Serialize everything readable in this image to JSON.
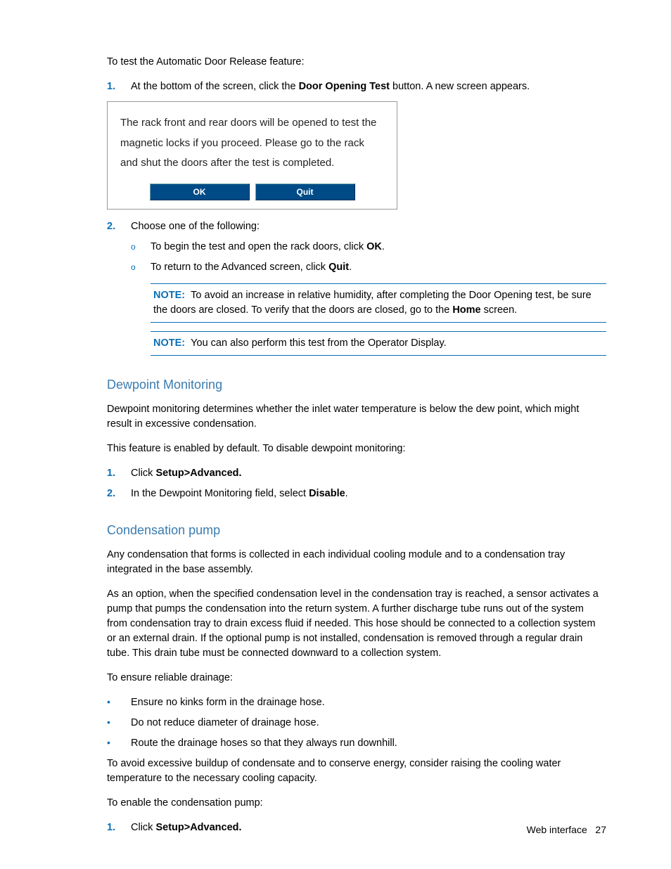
{
  "intro": "To test the Automatic Door Release feature:",
  "step1_pre": "At the bottom of the screen, click the ",
  "step1_bold": "Door Opening Test",
  "step1_post": " button. A new screen appears.",
  "dialog_text": "The rack front and rear doors will be opened to test the magnetic locks if you proceed. Please go to the rack and shut the doors after the test is completed.",
  "dialog_ok": "OK",
  "dialog_quit": "Quit",
  "step2": "Choose one of the following:",
  "sub_a_pre": "To begin the test and open the rack doors, click ",
  "sub_a_bold": "OK",
  "sub_a_post": ".",
  "sub_b_pre": "To return to the Advanced screen, click ",
  "sub_b_bold": "Quit",
  "sub_b_post": ".",
  "note_label": "NOTE:",
  "note1_pre": "To avoid an increase in relative humidity, after completing the Door Opening test, be sure the doors are closed. To verify that the doors are closed, go to the ",
  "note1_bold": "Home",
  "note1_post": " screen.",
  "note2": "You can also perform this test from the Operator Display.",
  "h_dew": "Dewpoint Monitoring",
  "dew_p1": "Dewpoint monitoring determines whether the inlet water temperature is below the dew point, which might result in excessive condensation.",
  "dew_p2": "This feature is enabled by default. To disable dewpoint monitoring:",
  "dew_s1_pre": "Click ",
  "dew_s1_bold": "Setup>Advanced.",
  "dew_s2_pre": "In the Dewpoint Monitoring field, select ",
  "dew_s2_bold": "Disable",
  "dew_s2_post": ".",
  "h_cond": "Condensation pump",
  "cond_p1": "Any condensation that forms is collected in each individual cooling module and to a condensation tray integrated in the base assembly.",
  "cond_p2": "As an option, when the specified condensation level in the condensation tray is reached, a sensor activates a pump that pumps the condensation into the return system. A further discharge tube runs out of the system from condensation tray to drain excess fluid if needed. This hose should be connected to a collection system or an external drain. If the optional pump is not installed, condensation is removed through a regular drain tube. This drain tube must be connected downward to a collection system.",
  "cond_p3": "To ensure reliable drainage:",
  "cond_b1": "Ensure no kinks form in the drainage hose.",
  "cond_b2": "Do not reduce diameter of drainage hose.",
  "cond_b3": "Route the drainage hoses so that they always run downhill.",
  "cond_p4": "To avoid excessive buildup of condensate and to conserve energy, consider raising the cooling water temperature to the necessary cooling capacity.",
  "cond_p5": "To enable the condensation pump:",
  "cond_s1_pre": "Click ",
  "cond_s1_bold": "Setup>Advanced.",
  "footer_label": "Web interface",
  "footer_page": "27",
  "marker_o": "o",
  "bullet": "•",
  "n1": "1.",
  "n2": "2."
}
